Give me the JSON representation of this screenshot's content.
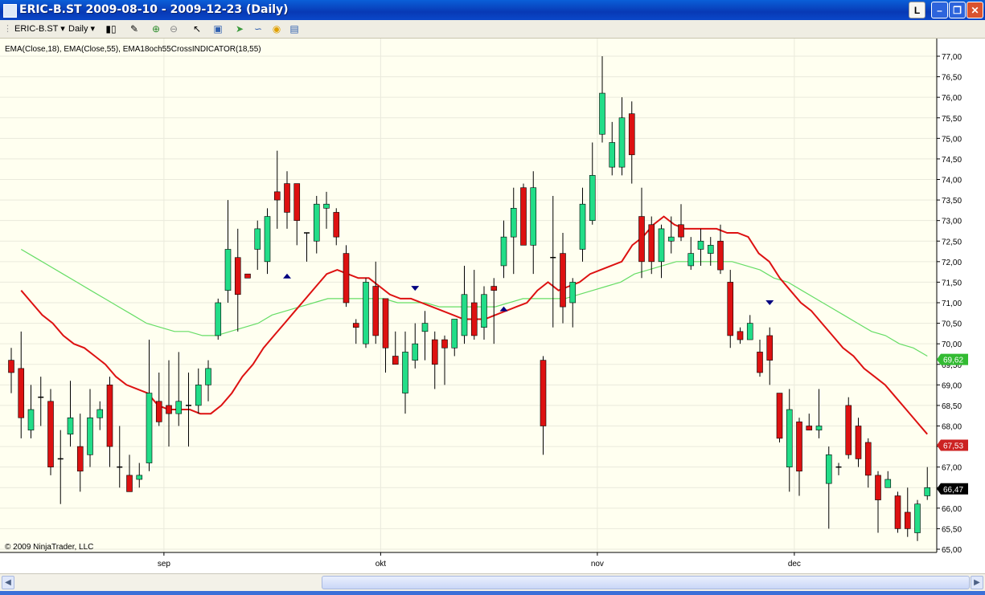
{
  "window": {
    "title": "ERIC-B.ST  2009-08-10 - 2009-12-23 (Daily)",
    "btn_l": "L"
  },
  "toolbar": {
    "instrument": "ERIC-B.ST",
    "period": "Daily"
  },
  "chart": {
    "indicator_label": "EMA(Close,18), EMA(Close,55), EMA18och55CrossINDICATOR(18,55)",
    "copyright": "© 2009 NinjaTrader, LLC",
    "badges": {
      "ema55": "69,62",
      "ema18": "67,53",
      "last": "66,47"
    }
  },
  "colors": {
    "background": "#fffff0",
    "up": "#22dd88",
    "down": "#dd1111",
    "ema18": "#dd1111",
    "ema55": "#66dd66",
    "marker": "#000080",
    "badge_ema55": "#33bb33",
    "badge_ema18": "#cc2222",
    "badge_last": "#000000"
  },
  "chart_data": {
    "type": "candlestick",
    "ylim": [
      65.0,
      77.0
    ],
    "y_ticks": [
      "65,00",
      "65,50",
      "66,00",
      "66,50",
      "67,00",
      "67,50",
      "68,00",
      "68,50",
      "69,00",
      "69,50",
      "70,00",
      "70,50",
      "71,00",
      "71,50",
      "72,00",
      "72,50",
      "73,00",
      "73,50",
      "74,00",
      "74,50",
      "75,00",
      "75,50",
      "76,00",
      "76,50",
      "77,00"
    ],
    "month_labels": [
      {
        "label": "sep",
        "index": 15.5
      },
      {
        "label": "okt",
        "index": 37.5
      },
      {
        "label": "nov",
        "index": 59.5
      },
      {
        "label": "dec",
        "index": 79.5
      }
    ],
    "candles": [
      {
        "o": 69.6,
        "h": 69.9,
        "l": 68.8,
        "c": 69.3
      },
      {
        "o": 69.4,
        "h": 70.3,
        "l": 67.7,
        "c": 68.2
      },
      {
        "o": 67.9,
        "h": 69.0,
        "l": 67.7,
        "c": 68.4
      },
      {
        "o": 68.7,
        "h": 69.2,
        "l": 68.0,
        "c": 68.7
      },
      {
        "o": 68.6,
        "h": 68.9,
        "l": 66.8,
        "c": 67.0
      },
      {
        "o": 67.2,
        "h": 67.9,
        "l": 66.1,
        "c": 67.2
      },
      {
        "o": 67.8,
        "h": 69.1,
        "l": 67.5,
        "c": 68.2
      },
      {
        "o": 67.5,
        "h": 68.3,
        "l": 66.4,
        "c": 66.9
      },
      {
        "o": 67.3,
        "h": 68.9,
        "l": 67.0,
        "c": 68.2
      },
      {
        "o": 68.2,
        "h": 68.6,
        "l": 67.9,
        "c": 68.4
      },
      {
        "o": 69.0,
        "h": 69.2,
        "l": 67.0,
        "c": 67.5
      },
      {
        "o": 67.0,
        "h": 68.0,
        "l": 66.5,
        "c": 67.0
      },
      {
        "o": 66.8,
        "h": 67.3,
        "l": 66.4,
        "c": 66.4
      },
      {
        "o": 66.7,
        "h": 67.1,
        "l": 66.5,
        "c": 66.8
      },
      {
        "o": 67.1,
        "h": 70.1,
        "l": 66.9,
        "c": 68.8
      },
      {
        "o": 68.6,
        "h": 69.3,
        "l": 68.0,
        "c": 68.1
      },
      {
        "o": 68.5,
        "h": 69.6,
        "l": 67.5,
        "c": 68.3
      },
      {
        "o": 68.3,
        "h": 69.8,
        "l": 68.0,
        "c": 68.6
      },
      {
        "o": 68.5,
        "h": 69.3,
        "l": 67.5,
        "c": 68.5
      },
      {
        "o": 68.5,
        "h": 69.4,
        "l": 68.3,
        "c": 69.0
      },
      {
        "o": 69.0,
        "h": 69.6,
        "l": 68.6,
        "c": 69.4
      },
      {
        "o": 70.2,
        "h": 71.1,
        "l": 70.1,
        "c": 71.0
      },
      {
        "o": 71.3,
        "h": 73.5,
        "l": 71.0,
        "c": 72.3
      },
      {
        "o": 72.1,
        "h": 72.8,
        "l": 70.3,
        "c": 71.2
      },
      {
        "o": 71.7,
        "h": 71.7,
        "l": 71.6,
        "c": 71.6
      },
      {
        "o": 72.3,
        "h": 73.0,
        "l": 71.8,
        "c": 72.8
      },
      {
        "o": 72.0,
        "h": 73.3,
        "l": 71.7,
        "c": 73.1
      },
      {
        "o": 73.7,
        "h": 74.7,
        "l": 72.8,
        "c": 73.5
      },
      {
        "o": 73.9,
        "h": 74.2,
        "l": 72.8,
        "c": 73.2
      },
      {
        "o": 73.9,
        "h": 73.9,
        "l": 72.4,
        "c": 73.0
      },
      {
        "o": 72.7,
        "h": 72.7,
        "l": 72.0,
        "c": 72.7
      },
      {
        "o": 72.5,
        "h": 73.6,
        "l": 72.2,
        "c": 73.4
      },
      {
        "o": 73.3,
        "h": 73.7,
        "l": 72.8,
        "c": 73.4
      },
      {
        "o": 73.2,
        "h": 73.3,
        "l": 72.4,
        "c": 72.6
      },
      {
        "o": 72.2,
        "h": 72.4,
        "l": 70.9,
        "c": 71.0
      },
      {
        "o": 70.5,
        "h": 70.6,
        "l": 70.0,
        "c": 70.4
      },
      {
        "o": 70.0,
        "h": 71.6,
        "l": 69.9,
        "c": 71.5
      },
      {
        "o": 71.4,
        "h": 72.0,
        "l": 70.0,
        "c": 70.2
      },
      {
        "o": 71.1,
        "h": 71.1,
        "l": 69.3,
        "c": 69.9
      },
      {
        "o": 69.7,
        "h": 70.3,
        "l": 69.5,
        "c": 69.5
      },
      {
        "o": 68.8,
        "h": 70.3,
        "l": 68.3,
        "c": 69.8
      },
      {
        "o": 69.6,
        "h": 70.5,
        "l": 69.4,
        "c": 70.0
      },
      {
        "o": 70.3,
        "h": 70.8,
        "l": 69.6,
        "c": 70.5
      },
      {
        "o": 70.1,
        "h": 70.3,
        "l": 68.9,
        "c": 69.5
      },
      {
        "o": 70.1,
        "h": 70.2,
        "l": 69.0,
        "c": 69.9
      },
      {
        "o": 69.9,
        "h": 70.6,
        "l": 69.7,
        "c": 70.6
      },
      {
        "o": 70.2,
        "h": 71.9,
        "l": 70.0,
        "c": 71.2
      },
      {
        "o": 71.0,
        "h": 71.8,
        "l": 70.1,
        "c": 70.2
      },
      {
        "o": 70.4,
        "h": 71.4,
        "l": 70.1,
        "c": 71.2
      },
      {
        "o": 71.4,
        "h": 71.6,
        "l": 70.0,
        "c": 71.3
      },
      {
        "o": 71.9,
        "h": 73.0,
        "l": 71.6,
        "c": 72.6
      },
      {
        "o": 72.6,
        "h": 73.8,
        "l": 71.7,
        "c": 73.3
      },
      {
        "o": 73.8,
        "h": 73.9,
        "l": 72.7,
        "c": 72.4
      },
      {
        "o": 72.4,
        "h": 74.2,
        "l": 71.7,
        "c": 73.8
      },
      {
        "o": 69.6,
        "h": 69.7,
        "l": 67.3,
        "c": 68.0
      },
      {
        "o": 72.1,
        "h": 73.6,
        "l": 70.4,
        "c": 72.1
      },
      {
        "o": 72.2,
        "h": 72.7,
        "l": 70.5,
        "c": 70.9
      },
      {
        "o": 71.0,
        "h": 71.6,
        "l": 70.4,
        "c": 71.5
      },
      {
        "o": 72.3,
        "h": 73.8,
        "l": 72.0,
        "c": 73.4
      },
      {
        "o": 73.0,
        "h": 74.9,
        "l": 72.9,
        "c": 74.1
      },
      {
        "o": 75.1,
        "h": 77.0,
        "l": 74.9,
        "c": 76.1
      },
      {
        "o": 74.3,
        "h": 75.4,
        "l": 74.1,
        "c": 74.9
      },
      {
        "o": 74.3,
        "h": 76.0,
        "l": 74.1,
        "c": 75.5
      },
      {
        "o": 75.6,
        "h": 75.9,
        "l": 73.9,
        "c": 74.6
      },
      {
        "o": 73.1,
        "h": 73.8,
        "l": 71.6,
        "c": 72.0
      },
      {
        "o": 72.9,
        "h": 73.1,
        "l": 71.7,
        "c": 72.0
      },
      {
        "o": 72.0,
        "h": 72.9,
        "l": 71.6,
        "c": 72.8
      },
      {
        "o": 72.5,
        "h": 73.1,
        "l": 72.2,
        "c": 72.6
      },
      {
        "o": 72.9,
        "h": 73.4,
        "l": 72.5,
        "c": 72.6
      },
      {
        "o": 71.9,
        "h": 72.6,
        "l": 71.8,
        "c": 72.2
      },
      {
        "o": 72.3,
        "h": 72.8,
        "l": 71.9,
        "c": 72.5
      },
      {
        "o": 72.2,
        "h": 72.6,
        "l": 71.9,
        "c": 72.4
      },
      {
        "o": 72.5,
        "h": 72.9,
        "l": 71.7,
        "c": 71.8
      },
      {
        "o": 71.5,
        "h": 71.8,
        "l": 69.9,
        "c": 70.2
      },
      {
        "o": 70.3,
        "h": 70.4,
        "l": 70.0,
        "c": 70.1
      },
      {
        "o": 70.1,
        "h": 70.7,
        "l": 70.1,
        "c": 70.5
      },
      {
        "o": 69.8,
        "h": 70.1,
        "l": 69.2,
        "c": 69.3
      },
      {
        "o": 70.2,
        "h": 70.4,
        "l": 69.0,
        "c": 69.6
      },
      {
        "o": 68.8,
        "h": 68.8,
        "l": 67.6,
        "c": 67.7
      },
      {
        "o": 67.0,
        "h": 68.9,
        "l": 66.4,
        "c": 68.4
      },
      {
        "o": 68.1,
        "h": 68.2,
        "l": 66.3,
        "c": 66.9
      },
      {
        "o": 68.0,
        "h": 68.3,
        "l": 67.9,
        "c": 67.9
      },
      {
        "o": 67.9,
        "h": 68.9,
        "l": 67.7,
        "c": 68.0
      },
      {
        "o": 66.6,
        "h": 67.5,
        "l": 65.5,
        "c": 67.3
      },
      {
        "o": 67.0,
        "h": 67.1,
        "l": 66.8,
        "c": 67.0
      },
      {
        "o": 68.5,
        "h": 68.7,
        "l": 67.2,
        "c": 67.3
      },
      {
        "o": 68.0,
        "h": 68.2,
        "l": 67.0,
        "c": 67.2
      },
      {
        "o": 67.6,
        "h": 67.7,
        "l": 66.5,
        "c": 66.8
      },
      {
        "o": 66.8,
        "h": 66.9,
        "l": 65.4,
        "c": 66.2
      },
      {
        "o": 66.5,
        "h": 66.9,
        "l": 66.5,
        "c": 66.7
      },
      {
        "o": 66.3,
        "h": 66.4,
        "l": 65.4,
        "c": 65.5
      },
      {
        "o": 65.9,
        "h": 66.5,
        "l": 65.3,
        "c": 65.5
      },
      {
        "o": 65.4,
        "h": 66.2,
        "l": 65.2,
        "c": 66.1
      },
      {
        "o": 66.3,
        "h": 67.0,
        "l": 66.2,
        "c": 66.5
      }
    ],
    "ema18": [
      71.3,
      71.0,
      70.7,
      70.5,
      70.2,
      70.0,
      69.9,
      69.7,
      69.5,
      69.2,
      69.0,
      68.9,
      68.8,
      68.5,
      68.4,
      68.4,
      68.4,
      68.3,
      68.3,
      68.5,
      68.8,
      69.2,
      69.5,
      69.9,
      70.2,
      70.5,
      70.8,
      71.1,
      71.4,
      71.7,
      71.8,
      71.7,
      71.6,
      71.6,
      71.4,
      71.2,
      71.1,
      71.1,
      71.0,
      70.9,
      70.8,
      70.7,
      70.6,
      70.6,
      70.6,
      70.7,
      70.8,
      70.9,
      71.0,
      71.3,
      71.5,
      71.3,
      71.4,
      71.5,
      71.7,
      71.8,
      71.9,
      72.0,
      72.4,
      72.6,
      72.9,
      73.1,
      72.9,
      72.8,
      72.8,
      72.8,
      72.8,
      72.7,
      72.7,
      72.6,
      72.2,
      72.0,
      71.6,
      71.3,
      71.0,
      70.8,
      70.5,
      70.2,
      69.9,
      69.7,
      69.4,
      69.2,
      69.0,
      68.7,
      68.4,
      68.1,
      67.8
    ],
    "ema18_start": 1,
    "ema55": [
      72.3,
      72.1,
      71.9,
      71.7,
      71.5,
      71.3,
      71.1,
      70.9,
      70.7,
      70.5,
      70.4,
      70.3,
      70.3,
      70.2,
      70.2,
      70.3,
      70.4,
      70.5,
      70.7,
      70.8,
      70.9,
      71.0,
      71.1,
      71.1,
      71.1,
      71.1,
      71.1,
      71.0,
      71.0,
      71.0,
      70.9,
      70.9,
      70.9,
      70.9,
      70.9,
      71.0,
      71.1,
      71.1,
      71.1,
      71.1,
      71.2,
      71.3,
      71.4,
      71.5,
      71.7,
      71.8,
      71.9,
      72.0,
      72.0,
      72.0,
      72.0,
      72.0,
      71.9,
      71.8,
      71.6,
      71.5,
      71.3,
      71.1,
      70.9,
      70.7,
      70.5,
      70.3,
      70.2,
      70.0,
      69.9,
      69.7
    ],
    "ema55_start": 1,
    "markers": [
      {
        "index": 28,
        "price": 71.65,
        "dir": "up"
      },
      {
        "index": 41,
        "price": 71.35,
        "dir": "down"
      },
      {
        "index": 50,
        "price": 70.85,
        "dir": "up"
      },
      {
        "index": 77,
        "price": 71.0,
        "dir": "down"
      }
    ]
  }
}
